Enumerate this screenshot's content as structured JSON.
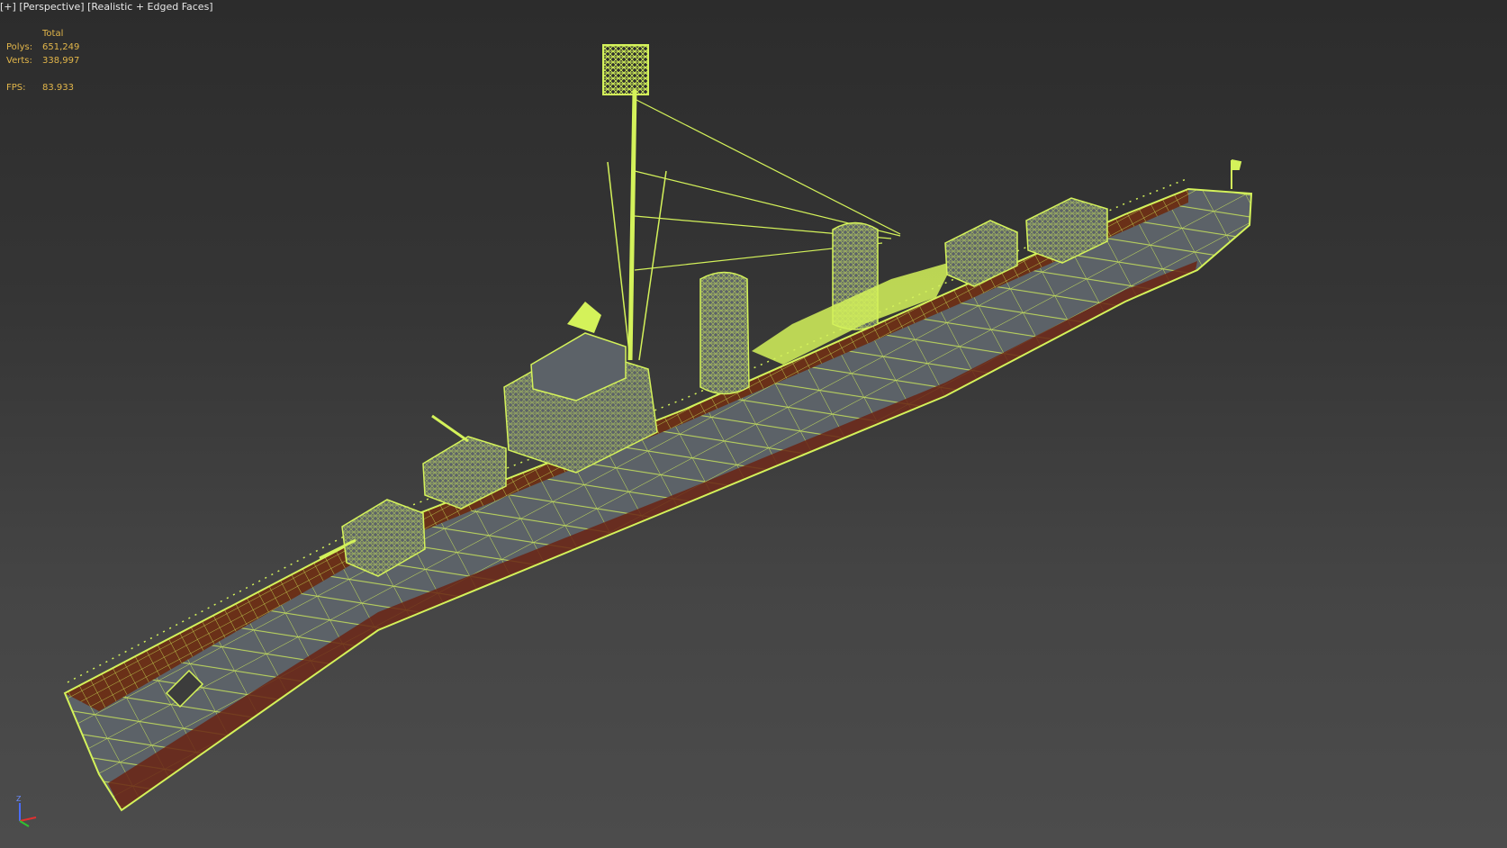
{
  "viewport": {
    "menu_plus": "[+]",
    "view": "[Perspective]",
    "shading": "[Realistic + Edged Faces]"
  },
  "stats": {
    "header": "Total",
    "polys_label": "Polys:",
    "polys_value": "651,249",
    "verts_label": "Verts:",
    "verts_value": "338,997",
    "fps_label": "FPS:",
    "fps_value": "83.933"
  },
  "gizmo": {
    "z_label": "Z"
  },
  "colors": {
    "wireframe": "#d4f25a",
    "hull": "#5c6268",
    "deck": "#6a3018",
    "stats_text": "#e2b64a"
  }
}
